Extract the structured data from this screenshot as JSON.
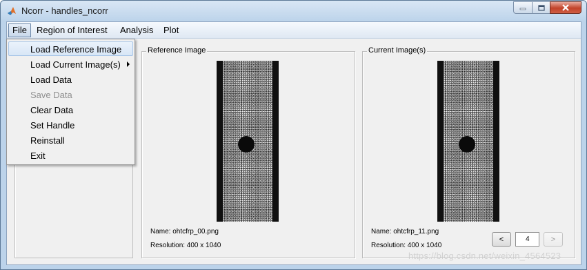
{
  "window": {
    "title": "Ncorr - handles_ncorr",
    "icon": "matlab-icon",
    "buttons": [
      "minimize-icon",
      "maximize-icon",
      "close-icon"
    ]
  },
  "menubar": {
    "items": [
      "File",
      "Region of Interest",
      "Analysis",
      "Plot"
    ],
    "active": "File"
  },
  "file_menu": {
    "items": [
      {
        "label": "Load Reference Image",
        "state": "highlighted"
      },
      {
        "label": "Load Current Image(s)",
        "submenu": true
      },
      {
        "label": "Load Data"
      },
      {
        "label": "Save Data",
        "state": "disabled"
      },
      {
        "label": "Clear Data"
      },
      {
        "label": "Set Handle"
      },
      {
        "label": "Reinstall"
      },
      {
        "label": "Exit"
      }
    ]
  },
  "reference_panel": {
    "title": "Reference Image",
    "name_line": "Name: ohtcfrp_00.png",
    "resolution_line": "Resolution: 400 x 1040"
  },
  "current_panel": {
    "title": "Current Image(s)",
    "name_line": "Name: ohtcfrp_11.png",
    "resolution_line": "Resolution: 400 x 1040",
    "prev_label": "<",
    "next_label": ">",
    "index_value": "4"
  },
  "watermark": "https://blog.csdn.net/weixin_4564523",
  "colors": {
    "titlebar": "#bcd3ea",
    "panel_bg": "#f0f0f0",
    "menu_highlight": "#d8e6f6"
  }
}
